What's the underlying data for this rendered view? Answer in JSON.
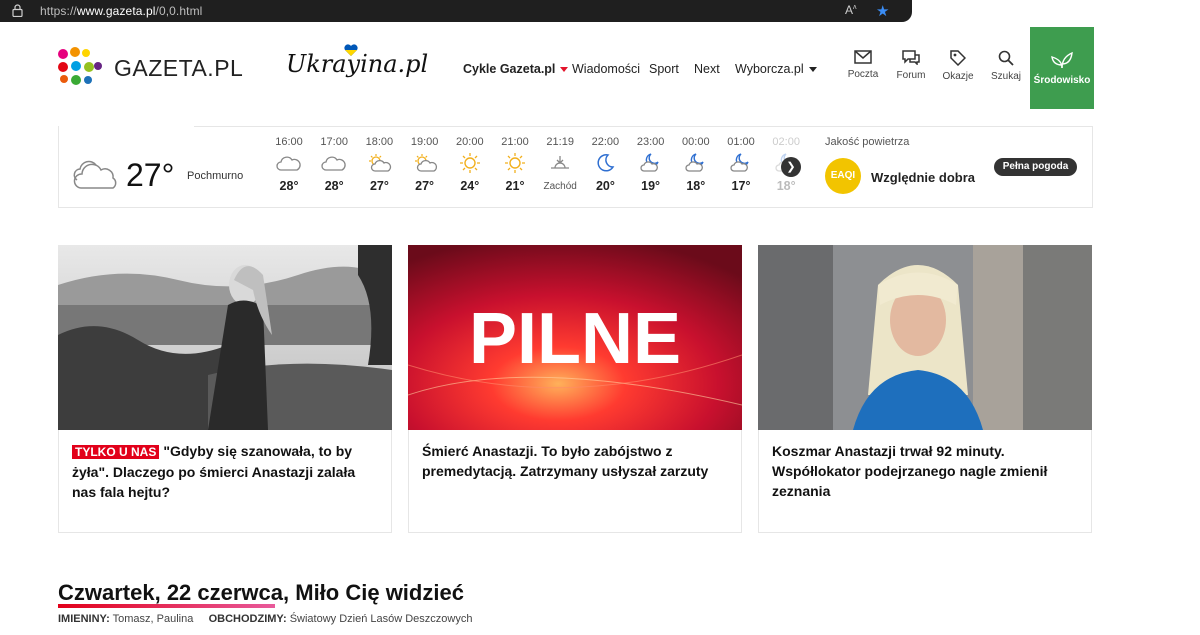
{
  "browser": {
    "url_prefix": "https://",
    "url_host": "www.gazeta.pl",
    "url_path": "/0,0.html"
  },
  "header": {
    "logo_text": "GAZETA.PL",
    "partner_logo": "Ukrayina.pl",
    "nav": [
      "Cykle Gazeta.pl",
      "Wiadomości",
      "Sport",
      "Next",
      "Wyborcza.pl"
    ],
    "tools": [
      "Poczta",
      "Forum",
      "Okazje",
      "Szukaj"
    ],
    "green_button": "Środowisko",
    "accent_green": "#3e9d4f"
  },
  "weather": {
    "current_temp": "27°",
    "current_desc": "Pochmurno",
    "hours": [
      {
        "time": "16:00",
        "icon": "cloud-icon",
        "value": "28°"
      },
      {
        "time": "17:00",
        "icon": "cloud-icon",
        "value": "28°"
      },
      {
        "time": "18:00",
        "icon": "partly-sunny-icon",
        "value": "27°"
      },
      {
        "time": "19:00",
        "icon": "partly-sunny-icon",
        "value": "27°"
      },
      {
        "time": "20:00",
        "icon": "sun-icon",
        "value": "24°"
      },
      {
        "time": "21:00",
        "icon": "sun-icon",
        "value": "21°"
      },
      {
        "time": "21:19",
        "icon": "sunset-icon",
        "value": "Zachód"
      },
      {
        "time": "22:00",
        "icon": "moon-icon",
        "value": "20°"
      },
      {
        "time": "23:00",
        "icon": "moon-cloud-icon",
        "value": "19°"
      },
      {
        "time": "00:00",
        "icon": "moon-cloud-icon",
        "value": "18°"
      },
      {
        "time": "01:00",
        "icon": "moon-cloud-icon",
        "value": "17°"
      },
      {
        "time": "02:00",
        "icon": "moon-cloud-icon",
        "value": "18°"
      }
    ],
    "air_quality_title": "Jakość powietrza",
    "air_quality_badge": "EAQI",
    "air_quality_label": "Względnie dobra",
    "full_forecast": "Pełna pogoda"
  },
  "cards": [
    {
      "tag": "TYLKO U NAS",
      "title": "\"Gdyby się szanowała, to by żyła\". Dlaczego po śmierci Anastazji zalała nas fala hejtu?"
    },
    {
      "image_text": "PILNE",
      "title": "Śmierć Anastazji. To było zabójstwo z premedytacją. Zatrzymany usłyszał zarzuty"
    },
    {
      "title": "Koszmar Anastazji trwał 92 minuty. Współlokator podejrzanego nagle zmienił zeznania"
    }
  ],
  "greeting": {
    "text": "Czwartek, 22 czerwca, Miło Cię widzieć",
    "nameday_label": "IMIENINY:",
    "nameday_value": "Tomasz, Paulina",
    "celebrate_label": "OBCHODZIMY:",
    "celebrate_value": "Światowy Dzień Lasów Deszczowych"
  }
}
